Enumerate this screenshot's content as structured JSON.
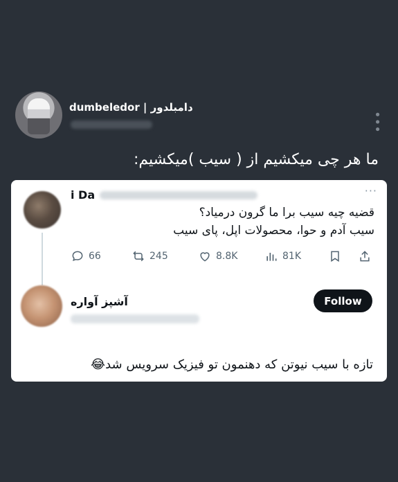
{
  "header": {
    "name": "dumbeledor | دامبلدور"
  },
  "caption": "ما هر چی میکشیم از ( سیب )میکشیم:",
  "tweet1": {
    "name": "i Da",
    "more": "···",
    "lines": [
      "قضیه چیه سیب برا ما گرون درمیاد؟",
      "سیب آدم و حوا، محصولات اپل، پای سیب"
    ],
    "replies": "66",
    "retweets": "245",
    "likes": "8.8K",
    "views": "81K"
  },
  "tweet2": {
    "name": "آشپز آواره",
    "follow_label": "Follow",
    "text": "تازه با سیب نیوتن که دهنمون تو فیزیک سرویس شد😂"
  },
  "icons": [
    "more-vertical-icon",
    "reply-icon",
    "retweet-icon",
    "like-icon",
    "views-icon",
    "bookmark-icon",
    "share-icon"
  ]
}
